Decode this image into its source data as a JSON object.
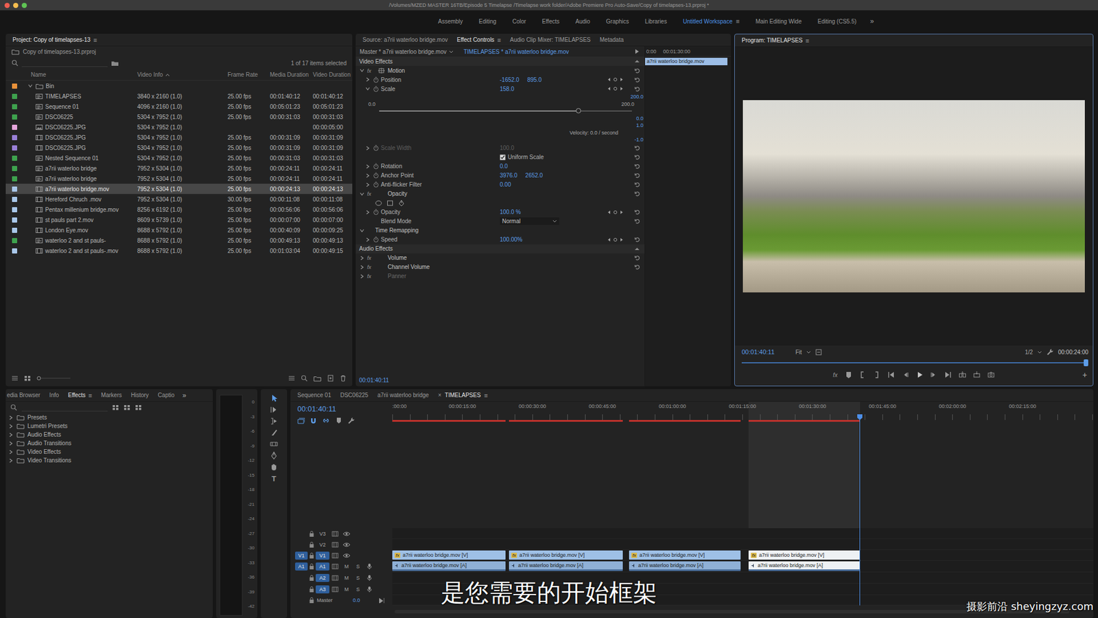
{
  "window": {
    "title": "/Volumes/MZED MASTER 16TB/Episode 5 Timelapse /Timelapse work folder/Adobe Premiere Pro Auto-Save/Copy of timelapses-13.prproj *"
  },
  "workspaces": {
    "items": [
      {
        "label": "Assembly",
        "selected": false
      },
      {
        "label": "Editing",
        "selected": false
      },
      {
        "label": "Color",
        "selected": false
      },
      {
        "label": "Effects",
        "selected": false
      },
      {
        "label": "Audio",
        "selected": false
      },
      {
        "label": "Graphics",
        "selected": false
      },
      {
        "label": "Libraries",
        "selected": false
      },
      {
        "label": "Untitled Workspace",
        "selected": true
      },
      {
        "label": "Main Editing Wide",
        "selected": false
      },
      {
        "label": "Editing (CS5.5)",
        "selected": false
      }
    ],
    "menu": "≡",
    "overflow": "»"
  },
  "project": {
    "tab": {
      "label": "Project: Copy of timelapses-13",
      "menu": "≡"
    },
    "file": "Copy of timelapses-13.prproj",
    "count": "1 of 17 items selected",
    "columns": [
      "Name",
      "Video Info",
      "Frame Rate",
      "Media Duration",
      "Video Duration"
    ],
    "bin": {
      "name": "Bin",
      "expanded": true,
      "color": "#e8913a"
    },
    "rows": [
      {
        "name": "TIMELAPSES",
        "video_info": "3840 x 2160 (1.0)",
        "frame_rate": "25.00 fps",
        "media_duration": "00:01:40:12",
        "video_duration": "00:01:40:12",
        "kind": "sequence",
        "color": "#3ea24e",
        "selected": false
      },
      {
        "name": "Sequence 01",
        "video_info": "4096 x 2160 (1.0)",
        "frame_rate": "25.00 fps",
        "media_duration": "00:05:01:23",
        "video_duration": "00:05:01:23",
        "kind": "sequence",
        "color": "#3ea24e",
        "selected": false
      },
      {
        "name": "DSC06225",
        "video_info": "5304 x 7952 (1.0)",
        "frame_rate": "25.00 fps",
        "media_duration": "00:00:31:03",
        "video_duration": "00:00:31:03",
        "kind": "sequence",
        "color": "#3ea24e",
        "selected": false
      },
      {
        "name": "DSC06225.JPG",
        "video_info": "5304 x 7952 (1.0)",
        "video_duration": "00:00:05:00",
        "kind": "still",
        "color": "#e6a6dc",
        "selected": false
      },
      {
        "name": "DSC06225.JPG",
        "video_info": "5304 x 7952 (1.0)",
        "frame_rate": "25.00 fps",
        "media_duration": "00:00:31:09",
        "video_duration": "00:00:31:09",
        "kind": "clip",
        "color": "#9a80d8",
        "selected": false
      },
      {
        "name": "DSC06225.JPG",
        "video_info": "5304 x 7952 (1.0)",
        "frame_rate": "25.00 fps",
        "media_duration": "00:00:31:09",
        "video_duration": "00:00:31:09",
        "kind": "clip",
        "color": "#9a80d8",
        "selected": false
      },
      {
        "name": "Nested Sequence 01",
        "video_info": "5304 x 7952 (1.0)",
        "frame_rate": "25.00 fps",
        "media_duration": "00:00:31:03",
        "video_duration": "00:00:31:03",
        "kind": "sequence",
        "color": "#3ea24e",
        "selected": false
      },
      {
        "name": "a7rii waterloo bridge",
        "video_info": "7952 x 5304 (1.0)",
        "frame_rate": "25.00 fps",
        "media_duration": "00:00:24:11",
        "video_duration": "00:00:24:11",
        "kind": "sequence",
        "color": "#3ea24e",
        "selected": false
      },
      {
        "name": "a7rii waterloo bridge",
        "video_info": "7952 x 5304 (1.0)",
        "frame_rate": "25.00 fps",
        "media_duration": "00:00:24:11",
        "video_duration": "00:00:24:11",
        "kind": "sequence",
        "color": "#3ea24e",
        "selected": false
      },
      {
        "name": "a7rii waterloo bridge.mov",
        "video_info": "7952 x 5304 (1.0)",
        "frame_rate": "25.00 fps",
        "media_duration": "00:00:24:13",
        "video_duration": "00:00:24:13",
        "kind": "clip",
        "color": "#a9c7ea",
        "selected": true
      },
      {
        "name": "Hereford Chruch .mov",
        "video_info": "7952 x 5304 (1.0)",
        "frame_rate": "30.00 fps",
        "media_duration": "00:00:11:08",
        "video_duration": "00:00:11:08",
        "kind": "clip",
        "color": "#a9c7ea",
        "selected": false
      },
      {
        "name": "Pentax millenium bridge.mov",
        "video_info": "8256 x 6192 (1.0)",
        "frame_rate": "25.00 fps",
        "media_duration": "00:00:56:06",
        "video_duration": "00:00:56:06",
        "kind": "clip",
        "color": "#a9c7ea",
        "selected": false
      },
      {
        "name": "st pauls part 2.mov",
        "video_info": "8609 x 5739 (1.0)",
        "frame_rate": "25.00 fps",
        "media_duration": "00:00:07:00",
        "video_duration": "00:00:07:00",
        "kind": "clip",
        "color": "#a9c7ea",
        "selected": false
      },
      {
        "name": "London Eye.mov",
        "video_info": "8688 x 5792 (1.0)",
        "frame_rate": "25.00 fps",
        "media_duration": "00:00:40:09",
        "video_duration": "00:00:09:25",
        "kind": "clip",
        "color": "#a9c7ea",
        "selected": false
      },
      {
        "name": "waterloo 2 and st pauls-",
        "video_info": "8688 x 5792 (1.0)",
        "frame_rate": "25.00 fps",
        "media_duration": "00:00:49:13",
        "video_duration": "00:00:49:13",
        "kind": "sequence",
        "color": "#3ea24e",
        "selected": false
      },
      {
        "name": "waterloo 2 and st pauls-.mov",
        "video_info": "8688 x 5792 (1.0)",
        "frame_rate": "25.00 fps",
        "media_duration": "00:01:03:04",
        "video_duration": "00:00:49:15",
        "kind": "clip",
        "color": "#a9c7ea",
        "selected": false
      }
    ]
  },
  "effect_controls": {
    "tabs": [
      {
        "label": "Source: a7rii waterloo bridge.mov",
        "selected": false
      },
      {
        "label": "Effect Controls",
        "selected": true
      },
      {
        "label": "Audio Clip Mixer: TIMELAPSES",
        "selected": false
      },
      {
        "label": "Metadata",
        "selected": false
      }
    ],
    "menu": "≡",
    "master": "Master * a7rii waterloo bridge.mov",
    "sequence_clip": "TIMELAPSES * a7rii waterloo bridge.mov",
    "ruler": [
      "0:00",
      "00:01:30:00"
    ],
    "clip": "a7rii waterloo bridge.mov",
    "video_heading": "Video Effects",
    "video_rows": [
      {
        "kind": "effect",
        "badge": "fx",
        "label": "Motion",
        "expanded": true,
        "transform_icon": true,
        "disabled": false
      },
      {
        "kind": "param",
        "label": "Position",
        "values": [
          "-1652.0",
          "895.0"
        ],
        "expanded": false,
        "keyframes": true,
        "disabled": false
      },
      {
        "kind": "param",
        "label": "Scale",
        "values": [
          "158.0"
        ],
        "expanded": true,
        "keyframes": true,
        "disabled": false
      },
      {
        "kind": "graph",
        "axis_top": "200.0",
        "min": "0.0",
        "max": "200.0",
        "level": 0.79,
        "axis_mid": "0.0",
        "axis_low": "1.0",
        "velocity": "Velocity: 0.0 / second",
        "axis_bottom": "-1.0"
      },
      {
        "kind": "param",
        "label": "Scale Width",
        "values": [
          "100.0"
        ],
        "expanded": false,
        "keyframes": false,
        "disabled": true
      },
      {
        "kind": "checkbox",
        "label": "Uniform Scale",
        "checked": true
      },
      {
        "kind": "param",
        "label": "Rotation",
        "values": [
          "0.0"
        ],
        "expanded": false,
        "keyframes": false,
        "disabled": false
      },
      {
        "kind": "param",
        "label": "Anchor Point",
        "values": [
          "3976.0",
          "2652.0"
        ],
        "expanded": false,
        "keyframes": false,
        "disabled": false
      },
      {
        "kind": "param",
        "label": "Anti-flicker Filter",
        "values": [
          "0.00"
        ],
        "expanded": false,
        "keyframes": false,
        "disabled": false
      },
      {
        "kind": "effect",
        "badge": "fx",
        "label": "Opacity",
        "expanded": true,
        "transform_icon": false,
        "disabled": false
      },
      {
        "kind": "masks"
      },
      {
        "kind": "param",
        "label": "Opacity",
        "values": [
          "100.0 %"
        ],
        "expanded": false,
        "keyframes": true,
        "disabled": false
      },
      {
        "kind": "select",
        "label": "Blend Mode",
        "value": "Normal"
      },
      {
        "kind": "group",
        "label": "Time Remapping",
        "expanded": true
      },
      {
        "kind": "param",
        "label": "Speed",
        "values": [
          "100.00%"
        ],
        "expanded": false,
        "keyframes": true,
        "disabled": false
      }
    ],
    "audio_heading": "Audio Effects",
    "audio_rows": [
      {
        "kind": "effect",
        "badge": "fx",
        "label": "Volume",
        "expanded": false,
        "transform_icon": false,
        "disabled": false
      },
      {
        "kind": "effect",
        "badge": "fx",
        "label": "Channel Volume",
        "expanded": false,
        "transform_icon": false,
        "disabled": false
      },
      {
        "kind": "effect",
        "badge": "fx",
        "label": "Panner",
        "expanded": false,
        "transform_icon": false,
        "disabled": true
      }
    ],
    "timecode": "00:01:40:11"
  },
  "program": {
    "tab": "Program: TIMELAPSES",
    "menu": "≡",
    "timecode": "00:01:40:11",
    "zoom": "Fit",
    "resolution": "1/2",
    "duration": "00:00:24:00",
    "scrub": {
      "level": 1.0
    },
    "buttons": [
      {
        "kind": "fx",
        "label": "fx"
      },
      {
        "kind": "marker"
      },
      {
        "kind": "in"
      },
      {
        "kind": "out"
      },
      {
        "kind": "go-in"
      },
      {
        "kind": "step-back"
      },
      {
        "kind": "play"
      },
      {
        "kind": "step-forward"
      },
      {
        "kind": "go-out"
      },
      {
        "kind": "insert"
      },
      {
        "kind": "overwrite"
      },
      {
        "kind": "export-frame"
      }
    ],
    "add": "+"
  },
  "effects_panel": {
    "tabs": [
      {
        "label": "edia Browser",
        "selected": false
      },
      {
        "label": "Info",
        "selected": false
      },
      {
        "label": "Effects",
        "selected": true
      },
      {
        "label": "Markers",
        "selected": false
      },
      {
        "label": "History",
        "selected": false
      },
      {
        "label": "Captio",
        "selected": false
      }
    ],
    "menu": "≡",
    "overflow": "»",
    "folders": [
      {
        "label": "Presets",
        "expanded": false
      },
      {
        "label": "Lumetri Presets",
        "expanded": false
      },
      {
        "label": "Audio Effects",
        "expanded": false
      },
      {
        "label": "Audio Transitions",
        "expanded": false
      },
      {
        "label": "Video Effects",
        "expanded": false
      },
      {
        "label": "Video Transitions",
        "expanded": false
      }
    ]
  },
  "meter": {
    "scale": [
      "0",
      "-3",
      "-6",
      "-9",
      "-12",
      "-15",
      "-18",
      "-21",
      "-24",
      "-27",
      "-30",
      "-33",
      "-36",
      "-39",
      "-42"
    ]
  },
  "tools": [
    {
      "kind": "selection",
      "selected": true
    },
    {
      "kind": "track-select",
      "selected": false
    },
    {
      "kind": "ripple",
      "selected": false
    },
    {
      "kind": "razor",
      "selected": false
    },
    {
      "kind": "slip",
      "selected": false
    },
    {
      "kind": "pen",
      "selected": false
    },
    {
      "kind": "hand",
      "selected": false
    },
    {
      "kind": "type",
      "selected": false,
      "label": "T"
    }
  ],
  "timeline": {
    "tabs": [
      {
        "label": "Sequence 01",
        "selected": false
      },
      {
        "label": "DSC06225",
        "selected": false
      },
      {
        "label": "a7rii waterloo bridge",
        "selected": false
      },
      {
        "label": "TIMELAPSES",
        "selected": true
      }
    ],
    "close": "×",
    "menu": "≡",
    "timecode": "00:01:40:11",
    "toggles": [
      {
        "kind": "nest",
        "on": true
      },
      {
        "kind": "snap",
        "on": true
      },
      {
        "kind": "linked",
        "on": true
      },
      {
        "kind": "marker",
        "on": false
      },
      {
        "kind": "settings",
        "on": false
      }
    ],
    "ruler": [
      ":00:00",
      "00:00:15:00",
      "00:00:30:00",
      "00:00:45:00",
      "00:01:00:00",
      "00:01:15:00",
      "00:01:30:00",
      "00:01:45:00",
      "00:02:00:00",
      "00:02:15:00"
    ],
    "tracks": [
      {
        "name": "V3",
        "kind": "video",
        "targeted": false,
        "clips": []
      },
      {
        "name": "V2",
        "kind": "video",
        "targeted": false,
        "clips": []
      },
      {
        "name": "V1",
        "kind": "video",
        "source": "V1",
        "targeted": true,
        "clips": [
          {
            "label": "a7rii waterloo bridge.mov [V]",
            "badge": "fx",
            "selected": false
          },
          {
            "label": "a7rii waterloo bridge.mov [V]",
            "badge": "fx",
            "selected": false
          },
          {
            "label": "a7rii waterloo bridge.mov [V]",
            "badge": "fx",
            "selected": false
          },
          {
            "label": "a7rii waterloo bridge.mov [V]",
            "badge": "fx",
            "selected": true
          }
        ]
      },
      {
        "name": "A1",
        "kind": "audio",
        "source": "A1",
        "targeted": true,
        "mute": "M",
        "solo": "S",
        "clips": [
          {
            "label": "a7rii waterloo bridge.mov [A]",
            "selected": false
          },
          {
            "label": "a7rii waterloo bridge.mov [A]",
            "selected": false
          },
          {
            "label": "a7rii waterloo bridge.mov [A]",
            "selected": false
          },
          {
            "label": "a7rii waterloo bridge.mov [A]",
            "selected": true
          }
        ]
      },
      {
        "name": "A2",
        "kind": "audio",
        "targeted": true,
        "mute": "M",
        "solo": "S",
        "clips": []
      },
      {
        "name": "A3",
        "kind": "audio",
        "targeted": true,
        "mute": "M",
        "solo": "S",
        "clips": []
      }
    ],
    "master": {
      "label": "Master",
      "value": "0.0"
    }
  },
  "overlay": {
    "subtitle": "是您需要的开始框架",
    "watermark": "摄影前沿 sheyingzyz.com"
  }
}
